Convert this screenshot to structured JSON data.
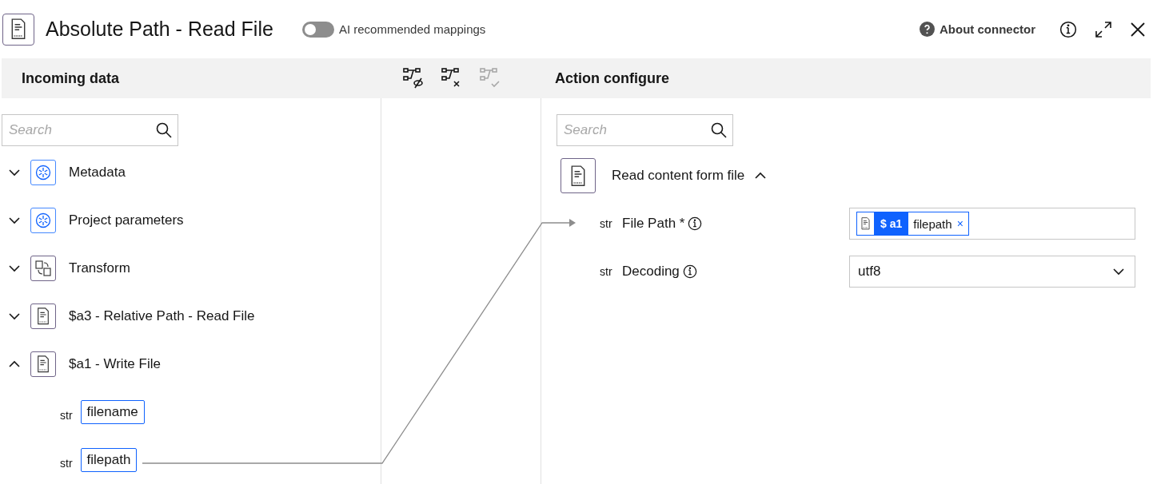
{
  "header": {
    "title": "Absolute Path - Read File",
    "toggle": {
      "label": "AI recommended mappings",
      "on": false
    },
    "about": "About connector"
  },
  "incoming": {
    "title": "Incoming data",
    "search": {
      "placeholder": "Search"
    },
    "items": [
      {
        "label": "Metadata",
        "kind": "params",
        "expanded": false
      },
      {
        "label": "Project parameters",
        "kind": "params",
        "expanded": false
      },
      {
        "label": "Transform",
        "kind": "transform",
        "expanded": false
      },
      {
        "label": "$a3 - Relative Path - Read File",
        "kind": "file",
        "expanded": false
      },
      {
        "label": "$a1 - Write File",
        "kind": "file",
        "expanded": true,
        "children": [
          {
            "type": "str",
            "name": "filename"
          },
          {
            "type": "str",
            "name": "filepath"
          }
        ]
      }
    ]
  },
  "toolbar": [
    {
      "kind": "hide",
      "disabled": false
    },
    {
      "kind": "clear",
      "disabled": false
    },
    {
      "kind": "accept",
      "disabled": true
    }
  ],
  "action": {
    "title": "Action configure",
    "search": {
      "placeholder": "Search"
    },
    "node": {
      "label": "Read content form file",
      "expanded": true
    },
    "fields": [
      {
        "kind": "mapped",
        "type": "str",
        "label": "File Path *",
        "chip": {
          "source": "$ a1",
          "name": "filepath",
          "close": "×"
        }
      },
      {
        "kind": "select",
        "type": "str",
        "label": "Decoding",
        "value": "utf8"
      }
    ]
  }
}
